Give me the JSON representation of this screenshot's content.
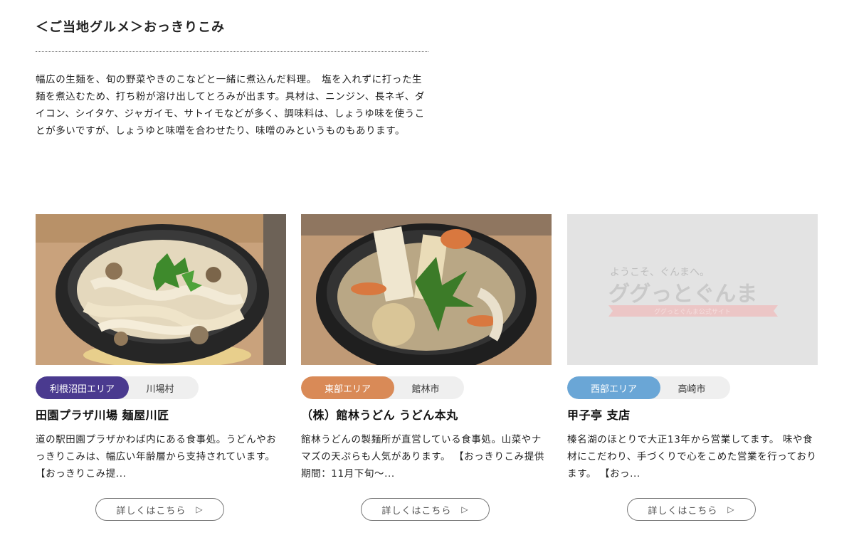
{
  "section": {
    "title": "＜ご当地グルメ＞おっきりこみ",
    "description": "幅広の生麺を、旬の野菜やきのこなどと一緒に煮込んだ料理。　塩を入れずに打った生麺を煮込むため、打ち粉が溶け出してとろみが出ます。具材は、ニンジン、長ネギ、ダイコン、シイタケ、ジャガイモ、サトイモなどが多く、調味料は、しょうゆ味を使うことが多いですが、しょうゆと味噌を合わせたり、味噌のみというものもあります。"
  },
  "cards": [
    {
      "area": "利根沼田エリア",
      "area_color": "#4a3a8f",
      "city": "川場村",
      "name": "田園プラザ川場 麺屋川匠",
      "description": "道の駅田園プラザかわば内にある食事処。うどんやおっきりこみは、幅広い年齢層から支持されています。 【おっきりこみ提...",
      "button": "詳しくはこちら",
      "image": "okkirikomi-pot-photo"
    },
    {
      "area": "東部エリア",
      "area_color": "#d98a57",
      "city": "館林市",
      "name": "（株）館林うどん うどん本丸",
      "description": "館林うどんの製麺所が直営している食事処。山菜やナマズの天ぷらも人気があります。 【おっきりこみ提供期間：11月下旬〜...",
      "button": "詳しくはこちら",
      "image": "okkirikomi-pot-photo"
    },
    {
      "area": "西部エリア",
      "area_color": "#6aa6d6",
      "city": "高崎市",
      "name": "甲子亭 支店",
      "description": "榛名湖のほとりで大正13年から営業してます。 味や食材にこだわり、手づくりで心をこめた営業を行っております。 【おっ...",
      "button": "詳しくはこちら",
      "image": "placeholder-logo",
      "placeholder": {
        "tagline": "ようこそ、ぐんまへ。",
        "logo": "ググっとぐんま",
        "subtitle": "ググっとぐんま公式サイト"
      }
    }
  ]
}
